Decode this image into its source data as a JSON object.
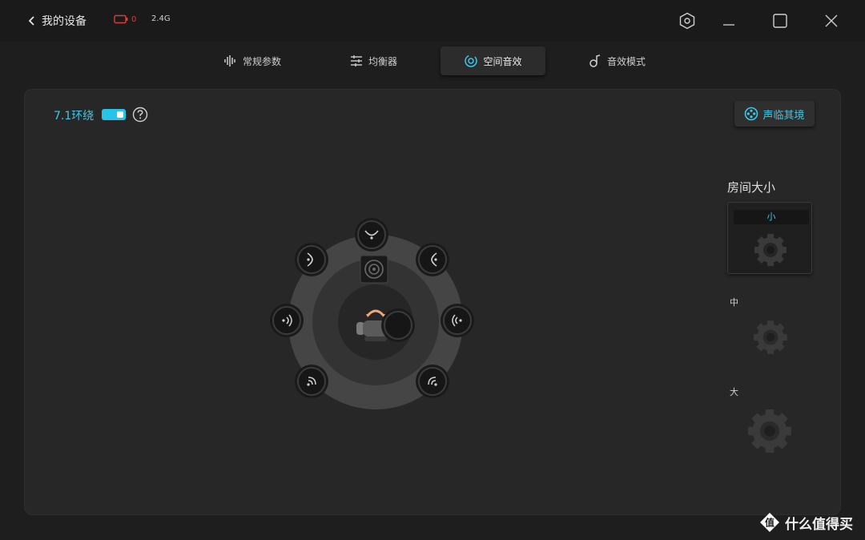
{
  "titlebar": {
    "back_label": "我的设备",
    "battery_value": "0",
    "wireless_band": "2.4G"
  },
  "tabs": [
    {
      "label": "常规参数",
      "icon": "waveform-icon"
    },
    {
      "label": "均衡器",
      "icon": "sliders-icon"
    },
    {
      "label": "空间音效",
      "icon": "spatial-audio-icon",
      "active": true
    },
    {
      "label": "音效模式",
      "icon": "music-note-icon"
    }
  ],
  "panel": {
    "surround_label": "7.1环绕",
    "surround_enabled": true,
    "immersive_label": "声临其境"
  },
  "room_size": {
    "title": "房间大小",
    "options": [
      {
        "label": "小",
        "selected": true
      },
      {
        "label": "中",
        "selected": false
      },
      {
        "label": "大",
        "selected": false
      }
    ]
  },
  "watermark": "什么值得买",
  "colors": {
    "accent": "#27c4e8",
    "battery_low": "#e03a3a",
    "background": "#1e1e1e",
    "panel": "#272727"
  }
}
